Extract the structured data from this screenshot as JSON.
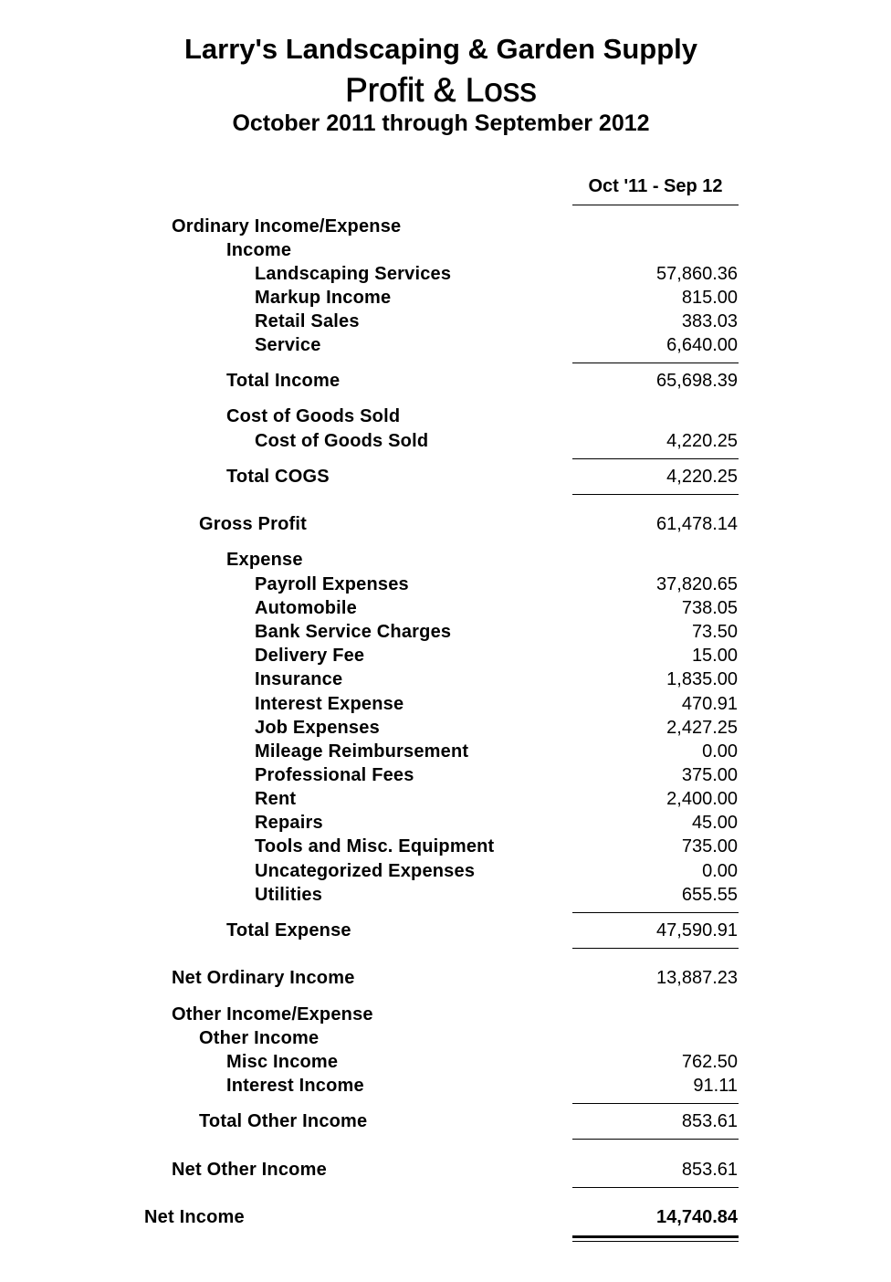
{
  "report": {
    "company": "Larry's Landscaping & Garden Supply",
    "title": "Profit & Loss",
    "period": "October 2011 through September 2012",
    "column_header": "Oct '11 - Sep 12"
  },
  "rows": {
    "ordinary_income_expense": {
      "label": "Ordinary Income/Expense"
    },
    "income": {
      "label": "Income"
    },
    "landscaping_services": {
      "label": "Landscaping Services",
      "amount": "57,860.36"
    },
    "markup_income": {
      "label": "Markup Income",
      "amount": "815.00"
    },
    "retail_sales": {
      "label": "Retail Sales",
      "amount": "383.03"
    },
    "service": {
      "label": "Service",
      "amount": "6,640.00"
    },
    "total_income": {
      "label": "Total Income",
      "amount": "65,698.39"
    },
    "cogs_header": {
      "label": "Cost of Goods Sold"
    },
    "cogs": {
      "label": "Cost of Goods Sold",
      "amount": "4,220.25"
    },
    "total_cogs": {
      "label": "Total COGS",
      "amount": "4,220.25"
    },
    "gross_profit": {
      "label": "Gross Profit",
      "amount": "61,478.14"
    },
    "expense": {
      "label": "Expense"
    },
    "payroll_expenses": {
      "label": "Payroll Expenses",
      "amount": "37,820.65"
    },
    "automobile": {
      "label": "Automobile",
      "amount": "738.05"
    },
    "bank_service_charges": {
      "label": "Bank Service Charges",
      "amount": "73.50"
    },
    "delivery_fee": {
      "label": "Delivery Fee",
      "amount": "15.00"
    },
    "insurance": {
      "label": "Insurance",
      "amount": "1,835.00"
    },
    "interest_expense": {
      "label": "Interest Expense",
      "amount": "470.91"
    },
    "job_expenses": {
      "label": "Job Expenses",
      "amount": "2,427.25"
    },
    "mileage_reimbursement": {
      "label": "Mileage Reimbursement",
      "amount": "0.00"
    },
    "professional_fees": {
      "label": "Professional Fees",
      "amount": "375.00"
    },
    "rent": {
      "label": "Rent",
      "amount": "2,400.00"
    },
    "repairs": {
      "label": "Repairs",
      "amount": "45.00"
    },
    "tools_misc_equipment": {
      "label": "Tools and Misc. Equipment",
      "amount": "735.00"
    },
    "uncategorized_expenses": {
      "label": "Uncategorized Expenses",
      "amount": "0.00"
    },
    "utilities": {
      "label": "Utilities",
      "amount": "655.55"
    },
    "total_expense": {
      "label": "Total Expense",
      "amount": "47,590.91"
    },
    "net_ordinary_income": {
      "label": "Net Ordinary Income",
      "amount": "13,887.23"
    },
    "other_income_expense": {
      "label": "Other Income/Expense"
    },
    "other_income": {
      "label": "Other Income"
    },
    "misc_income": {
      "label": "Misc Income",
      "amount": "762.50"
    },
    "interest_income": {
      "label": "Interest Income",
      "amount": "91.11"
    },
    "total_other_income": {
      "label": "Total Other Income",
      "amount": "853.61"
    },
    "net_other_income": {
      "label": "Net Other Income",
      "amount": "853.61"
    },
    "net_income": {
      "label": "Net Income",
      "amount": "14,740.84"
    }
  }
}
